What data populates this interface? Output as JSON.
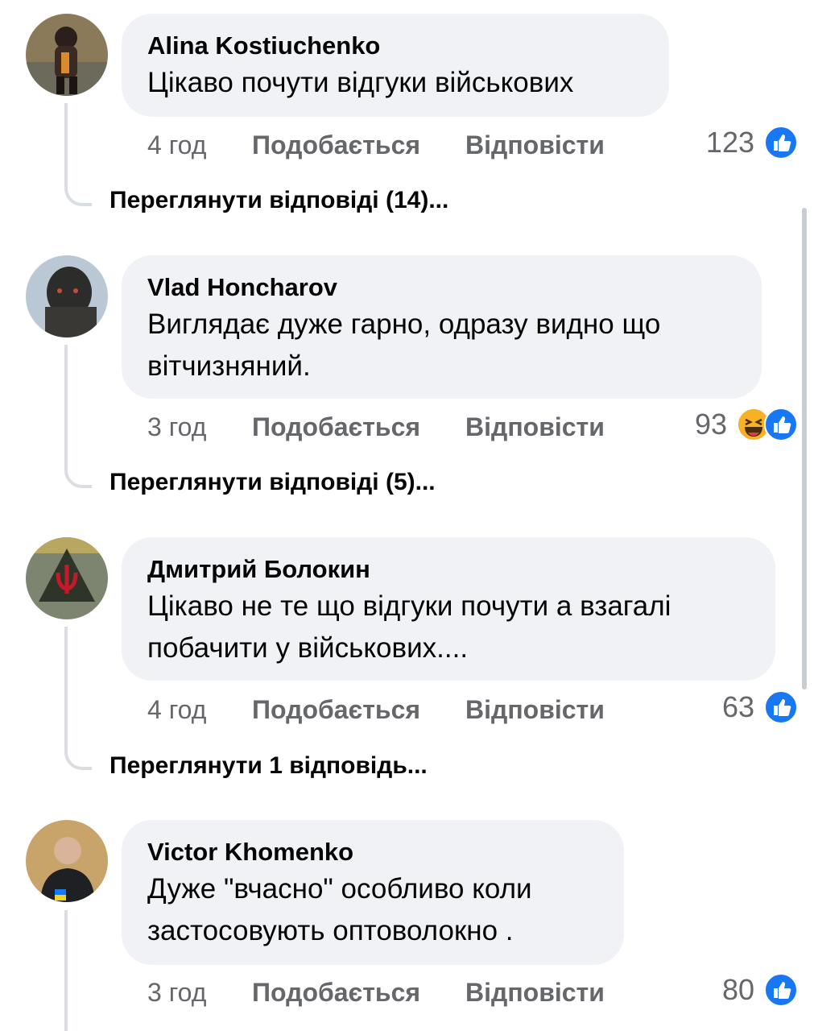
{
  "comments": [
    {
      "author": "Alina Kostiuchenko",
      "text": "Цікаво почути відгуки військових",
      "time": "4 год",
      "like_label": "Подобається",
      "reply_label": "Відповісти",
      "reaction_count": "123",
      "reactions": [
        "like"
      ],
      "view_replies": "Переглянути відповіді (14)..."
    },
    {
      "author": "Vlad Honcharov",
      "text": "Виглядає дуже гарно, одразу видно що вітчизняний.",
      "time": "3 год",
      "like_label": "Подобається",
      "reply_label": "Відповісти",
      "reaction_count": "93",
      "reactions": [
        "haha",
        "like"
      ],
      "view_replies": "Переглянути відповіді (5)..."
    },
    {
      "author": "Дмитрий Болокин",
      "text": "Цікаво не те що відгуки почути а взагалі побачити у військових....",
      "time": "4 год",
      "like_label": "Подобається",
      "reply_label": "Відповісти",
      "reaction_count": "63",
      "reactions": [
        "like"
      ],
      "view_replies": "Переглянути 1 відповідь..."
    },
    {
      "author": "Victor Khomenko",
      "text": "Дуже \"вчасно\" особливо коли застосовують оптоволокно .",
      "time": "3 год",
      "like_label": "Подобається",
      "reply_label": "Відповісти",
      "reaction_count": "80",
      "reactions": [
        "like"
      ]
    }
  ],
  "colors": {
    "bubble": "#f0f2f5",
    "meta_text": "#65676b",
    "like_blue": "#1877f2",
    "haha_yellow": "#f7b125",
    "thread_line": "#dadde1"
  }
}
